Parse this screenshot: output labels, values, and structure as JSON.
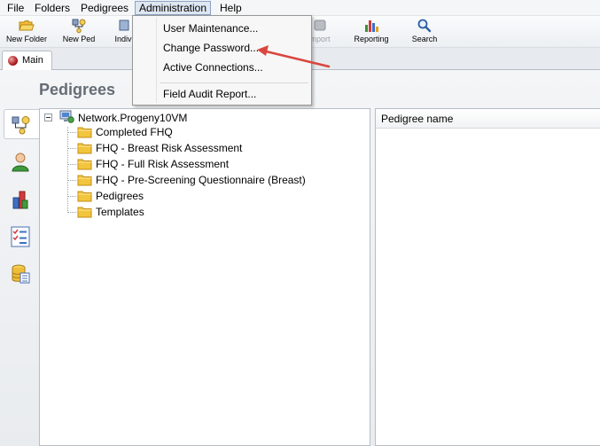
{
  "menubar": {
    "items": [
      "File",
      "Folders",
      "Pedigrees",
      "Administration",
      "Help"
    ],
    "open_item": "Administration"
  },
  "toolbar": {
    "new_folder": "New Folder",
    "new_ped": "New Ped",
    "individual_partial": "Indiv",
    "import_partial": "mport",
    "reporting": "Reporting",
    "search": "Search"
  },
  "tabs": {
    "main": "Main"
  },
  "page": {
    "title": "Pedigrees"
  },
  "tree": {
    "root": "Network.Progeny10VM",
    "folders": [
      "Completed FHQ",
      "FHQ - Breast Risk Assessment",
      "FHQ - Full Risk Assessment",
      "FHQ - Pre-Screening Questionnaire (Breast)",
      "Pedigrees",
      "Templates"
    ]
  },
  "grid": {
    "column": "Pedigree name"
  },
  "administration_menu": {
    "items": [
      "User Maintenance...",
      "Change Password...",
      "Active Connections...",
      "Field Audit Report..."
    ]
  },
  "colors": {
    "annotation_arrow": "#d9463f",
    "folder": "#f3c53f",
    "menu_highlight": "#dde6f1"
  },
  "icons": {
    "side_rail": [
      "pedigree-tree-icon",
      "person-icon",
      "chart-icon",
      "checklist-icon",
      "database-icon"
    ]
  }
}
